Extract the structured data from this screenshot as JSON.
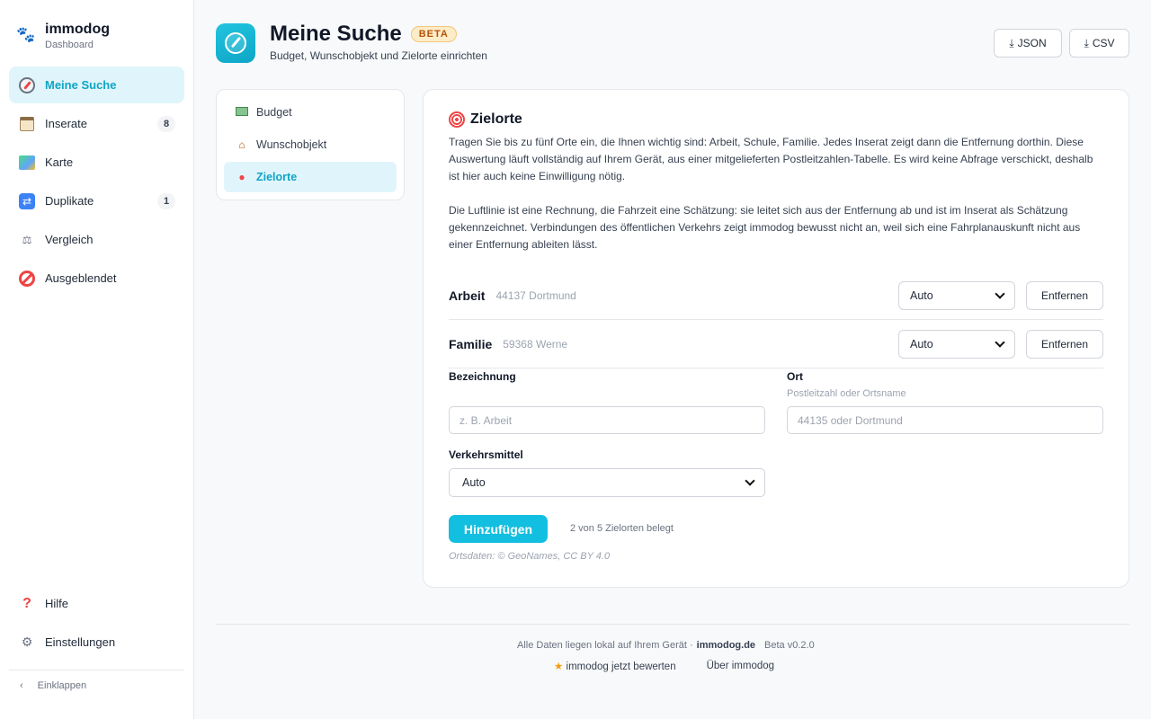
{
  "brand": {
    "name": "immodog",
    "sub": "Dashboard"
  },
  "sidebar": {
    "items": [
      {
        "label": "Meine Suche",
        "icon": "compass-icon"
      },
      {
        "label": "Inserate",
        "icon": "calendar-icon",
        "count": "8"
      },
      {
        "label": "Karte",
        "icon": "map-icon"
      },
      {
        "label": "Duplikate",
        "icon": "shuffle-icon",
        "count": "1"
      },
      {
        "label": "Vergleich",
        "icon": "scale-icon"
      },
      {
        "label": "Ausgeblendet",
        "icon": "no-entry-icon"
      }
    ],
    "bottom": [
      {
        "label": "Hilfe",
        "icon": "question-icon"
      },
      {
        "label": "Einstellungen",
        "icon": "gear-icon"
      }
    ],
    "collapse": "Einklappen"
  },
  "header": {
    "title": "Meine Suche",
    "badge": "BETA",
    "subtitle": "Budget, Wunschobjekt und Zielorte einrichten",
    "export_json": "JSON",
    "export_csv": "CSV"
  },
  "sections": [
    {
      "label": "Budget",
      "icon": "money-icon"
    },
    {
      "label": "Wunschobjekt",
      "icon": "house-icon"
    },
    {
      "label": "Zielorte",
      "icon": "pin-icon"
    }
  ],
  "card": {
    "title": "Zielorte",
    "p1": "Tragen Sie bis zu fünf Orte ein, die Ihnen wichtig sind: Arbeit, Schule, Familie. Jedes Inserat zeigt dann die Entfernung dorthin. Diese Auswertung läuft vollständig auf Ihrem Gerät, aus einer mitgelieferten Postleitzahlen-Tabelle. Es wird keine Abfrage verschickt, deshalb ist hier auch keine Einwilligung nötig.",
    "p2": "Die Luftlinie ist eine Rechnung, die Fahrzeit eine Schätzung: sie leitet sich aus der Entfernung ab und ist im Inserat als Schätzung gekennzeichnet. Verbindungen des öffentlichen Verkehrs zeigt immodog bewusst nicht an, weil sich eine Fahrplanauskunft nicht aus einer Entfernung ableiten lässt.",
    "destinations": [
      {
        "name": "Arbeit",
        "place": "44137 Dortmund",
        "mode": "Auto",
        "remove": "Entfernen"
      },
      {
        "name": "Familie",
        "place": "59368 Werne",
        "mode": "Auto",
        "remove": "Entfernen"
      }
    ],
    "form": {
      "name_label": "Bezeichnung",
      "name_placeholder": "z. B. Arbeit",
      "place_label": "Ort",
      "place_hint": "Postleitzahl oder Ortsname",
      "place_placeholder": "44135 oder Dortmund",
      "mode_label": "Verkehrsmittel",
      "mode_value": "Auto"
    },
    "add_button": "Hinzufügen",
    "slots": "2 von 5 Zielorten belegt",
    "attribution": "Ortsdaten: © GeoNames, CC BY 4.0"
  },
  "footer": {
    "text": "Alle Daten liegen lokal auf Ihrem Gerät ·",
    "site": "immodog.de",
    "version": "Beta v0.2.0",
    "rate": "immodog jetzt bewerten",
    "about": "Über immodog"
  }
}
